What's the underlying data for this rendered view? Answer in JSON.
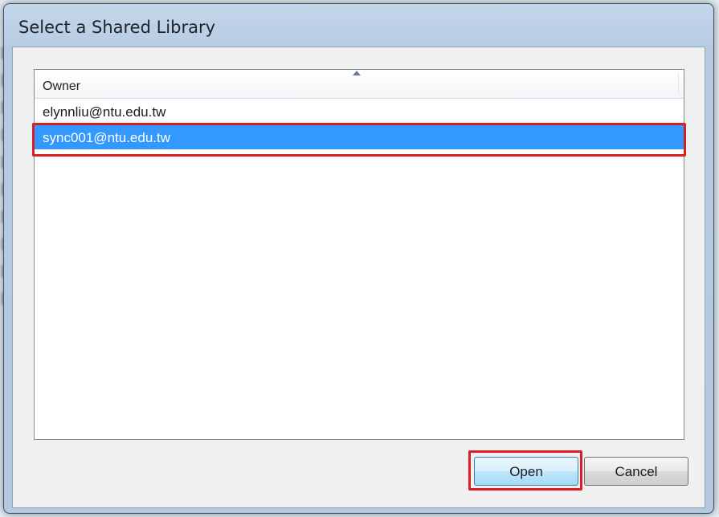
{
  "dialog": {
    "title": "Select a Shared Library"
  },
  "list": {
    "column_header": "Owner",
    "rows": [
      {
        "owner": "elynnliu@ntu.edu.tw",
        "selected": false
      },
      {
        "owner": "sync001@ntu.edu.tw",
        "selected": true
      }
    ]
  },
  "buttons": {
    "open_label": "Open",
    "cancel_label": "Cancel"
  },
  "colors": {
    "selection": "#3399ff",
    "highlight_box": "#d61f26",
    "dialog_frame": "#b5cae2"
  },
  "icons": {
    "sort": "sort-ascending-icon"
  }
}
